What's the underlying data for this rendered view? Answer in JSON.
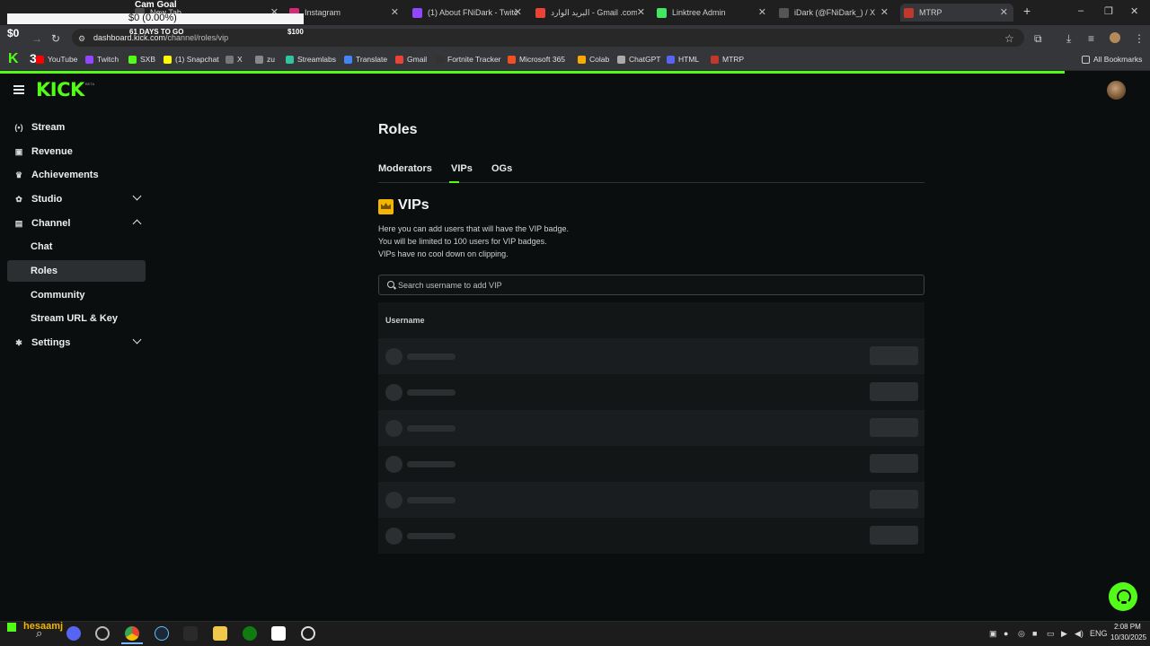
{
  "browser": {
    "tabs": [
      {
        "label": "New Tab",
        "color": "#4a4a4a"
      },
      {
        "label": "Instagram",
        "color": "#d62976"
      },
      {
        "label": "(1) About FNiDark - Twitc",
        "color": "#9146ff"
      },
      {
        "label": "البريد الوارد - Gmail .com",
        "color": "#ea4335"
      },
      {
        "label": "Linktree Admin",
        "color": "#43e660"
      },
      {
        "label": "iDark (@FNiDark_) / X",
        "color": "#555555"
      },
      {
        "label": "MTRP",
        "color": "#c0392b"
      }
    ],
    "url_host": "dashboard.kick.com",
    "url_path": "/channel/roles/vip",
    "bookmarks": [
      {
        "label": "YouTube",
        "color": "#ff0000"
      },
      {
        "label": "Twitch",
        "color": "#9146ff"
      },
      {
        "label": "SXB",
        "color": "#53fc18"
      },
      {
        "label": "(1) Snapchat",
        "color": "#fffc00"
      },
      {
        "label": "X",
        "color": "#777777"
      },
      {
        "label": "zu",
        "color": "#888888"
      },
      {
        "label": "Streamlabs",
        "color": "#31c3a2"
      },
      {
        "label": "Translate",
        "color": "#4285f4"
      },
      {
        "label": "Gmail",
        "color": "#ea4335"
      },
      {
        "label": "Fortnite Tracker",
        "color": "#333333"
      },
      {
        "label": "Microsoft 365",
        "color": "#f25022"
      },
      {
        "label": "Colab",
        "color": "#f9ab00"
      },
      {
        "label": "ChatGPT",
        "color": "#aaaaaa"
      },
      {
        "label": "HTML",
        "color": "#5865f2"
      },
      {
        "label": "MTRP",
        "color": "#c0392b"
      }
    ],
    "all_bookmarks": "All Bookmarks"
  },
  "goal_overlay": {
    "title": "Cam Goal",
    "amount": "$0 (0.00%)",
    "left_value": "$0",
    "days": "61 DAYS TO GO",
    "target": "$100",
    "progress": 0
  },
  "app": {
    "logo": "KICK",
    "beta": "BETA",
    "accent": "#53fc18"
  },
  "sidebar": {
    "items": [
      {
        "label": "Stream",
        "icon": "broadcast-icon"
      },
      {
        "label": "Revenue",
        "icon": "wallet-icon"
      },
      {
        "label": "Achievements",
        "icon": "trophy-icon"
      },
      {
        "label": "Studio",
        "icon": "studio-icon"
      },
      {
        "label": "Channel",
        "icon": "channel-icon"
      }
    ],
    "channel_sub": [
      "Chat",
      "Roles",
      "Community",
      "Stream URL & Key"
    ],
    "settings": "Settings"
  },
  "main": {
    "title": "Roles",
    "tabs": [
      "Moderators",
      "VIPs",
      "OGs"
    ],
    "active_tab": "VIPs",
    "section_title": "VIPs",
    "description": [
      "Here you can add users that will have the VIP badge.",
      "You will be limited to 100 users for VIP badges.",
      "VIPs have no cool down on clipping."
    ],
    "search_placeholder": "Search username to add VIP",
    "table_header": "Username",
    "loading_rows": 6
  },
  "taskbar": {
    "user_tag": "hesaamj",
    "lang": "ENG",
    "time": "2:08 PM",
    "date": "10/30/2025"
  }
}
